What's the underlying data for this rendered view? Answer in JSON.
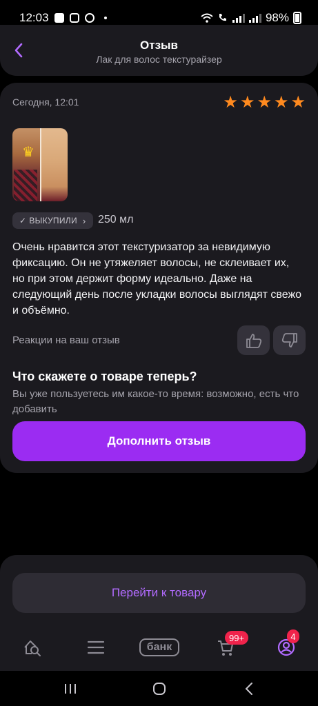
{
  "status_bar": {
    "time": "12:03",
    "battery": "98%"
  },
  "header": {
    "title": "Отзыв",
    "subtitle": "Лак для волос текстурайзер"
  },
  "review": {
    "date": "Сегодня, 12:01",
    "rating": 5,
    "badge_label": "ВЫКУПИЛИ",
    "volume": "250 мл",
    "text": "Очень нравится этот текстуризатор за невидимую фиксацию. Он не утяжеляет волосы, не склеивает их, но при этом держит форму идеально. Даже на следующий день после укладки волосы выглядят свежо и объёмно.",
    "reactions_label": "Реакции на ваш отзыв"
  },
  "cta": {
    "title": "Что скажете о товаре теперь?",
    "text": "Вы уже пользуетесь им какое-то время: возможно, есть что добавить",
    "button_label": "Дополнить отзыв"
  },
  "bottom_sheet": {
    "button_label": "Перейти к товару"
  },
  "nav": {
    "bank_label": "банк",
    "cart_badge": "99+",
    "profile_badge": "4"
  },
  "colors": {
    "accent": "#9b2cf2",
    "star": "#ff8a1f",
    "badge_red": "#f0234b",
    "card_bg": "#1b1a1f"
  }
}
